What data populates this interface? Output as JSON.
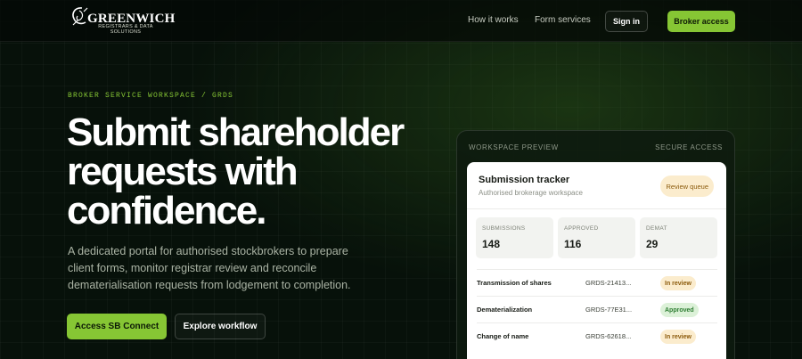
{
  "nav": {
    "brand_name": "GREENWICH",
    "brand_tagline_1": "REGISTRARS & DATA",
    "brand_tagline_2": "SOLUTIONS",
    "logo_icon": "greenwich-logo-mark",
    "links": [
      {
        "label": "How it works"
      },
      {
        "label": "Form services"
      }
    ],
    "signin_label": "Sign in",
    "broker_label": "Broker access"
  },
  "hero": {
    "eyebrow": "BROKER SERVICE WORKSPACE / GRDS",
    "headline_lines": [
      "Submit shareholder",
      "requests with",
      "confidence."
    ],
    "lead": "A dedicated portal for authorised stockbrokers to prepare client forms, monitor registrar review and reconcile dematerialisation requests from lodgement to completion.",
    "primary_cta": "Access SB Connect",
    "secondary_cta": "Explore workflow"
  },
  "preview": {
    "label_left": "WORKSPACE PREVIEW",
    "label_right": "SECURE ACCESS",
    "card": {
      "title": "Submission tracker",
      "subtitle": "Authorised brokerage workspace",
      "badge": "Review queue",
      "stats": [
        {
          "label": "SUBMISSIONS",
          "value": "148"
        },
        {
          "label": "APPROVED",
          "value": "116"
        },
        {
          "label": "DEMAT",
          "value": "29"
        }
      ],
      "rows": [
        {
          "name": "Transmission of shares",
          "ref": "GRDS-21413...",
          "status": "In review",
          "status_kind": "review"
        },
        {
          "name": "Dematerialization",
          "ref": "GRDS-77E31...",
          "status": "Approved",
          "status_kind": "approved"
        },
        {
          "name": "Change of name",
          "ref": "GRDS-62618...",
          "status": "In review",
          "status_kind": "review"
        }
      ]
    }
  },
  "colors": {
    "accent": "#86c634",
    "background": "#07110a",
    "review_bg": "#fbeccd",
    "approved_bg": "#dcf1d8"
  }
}
